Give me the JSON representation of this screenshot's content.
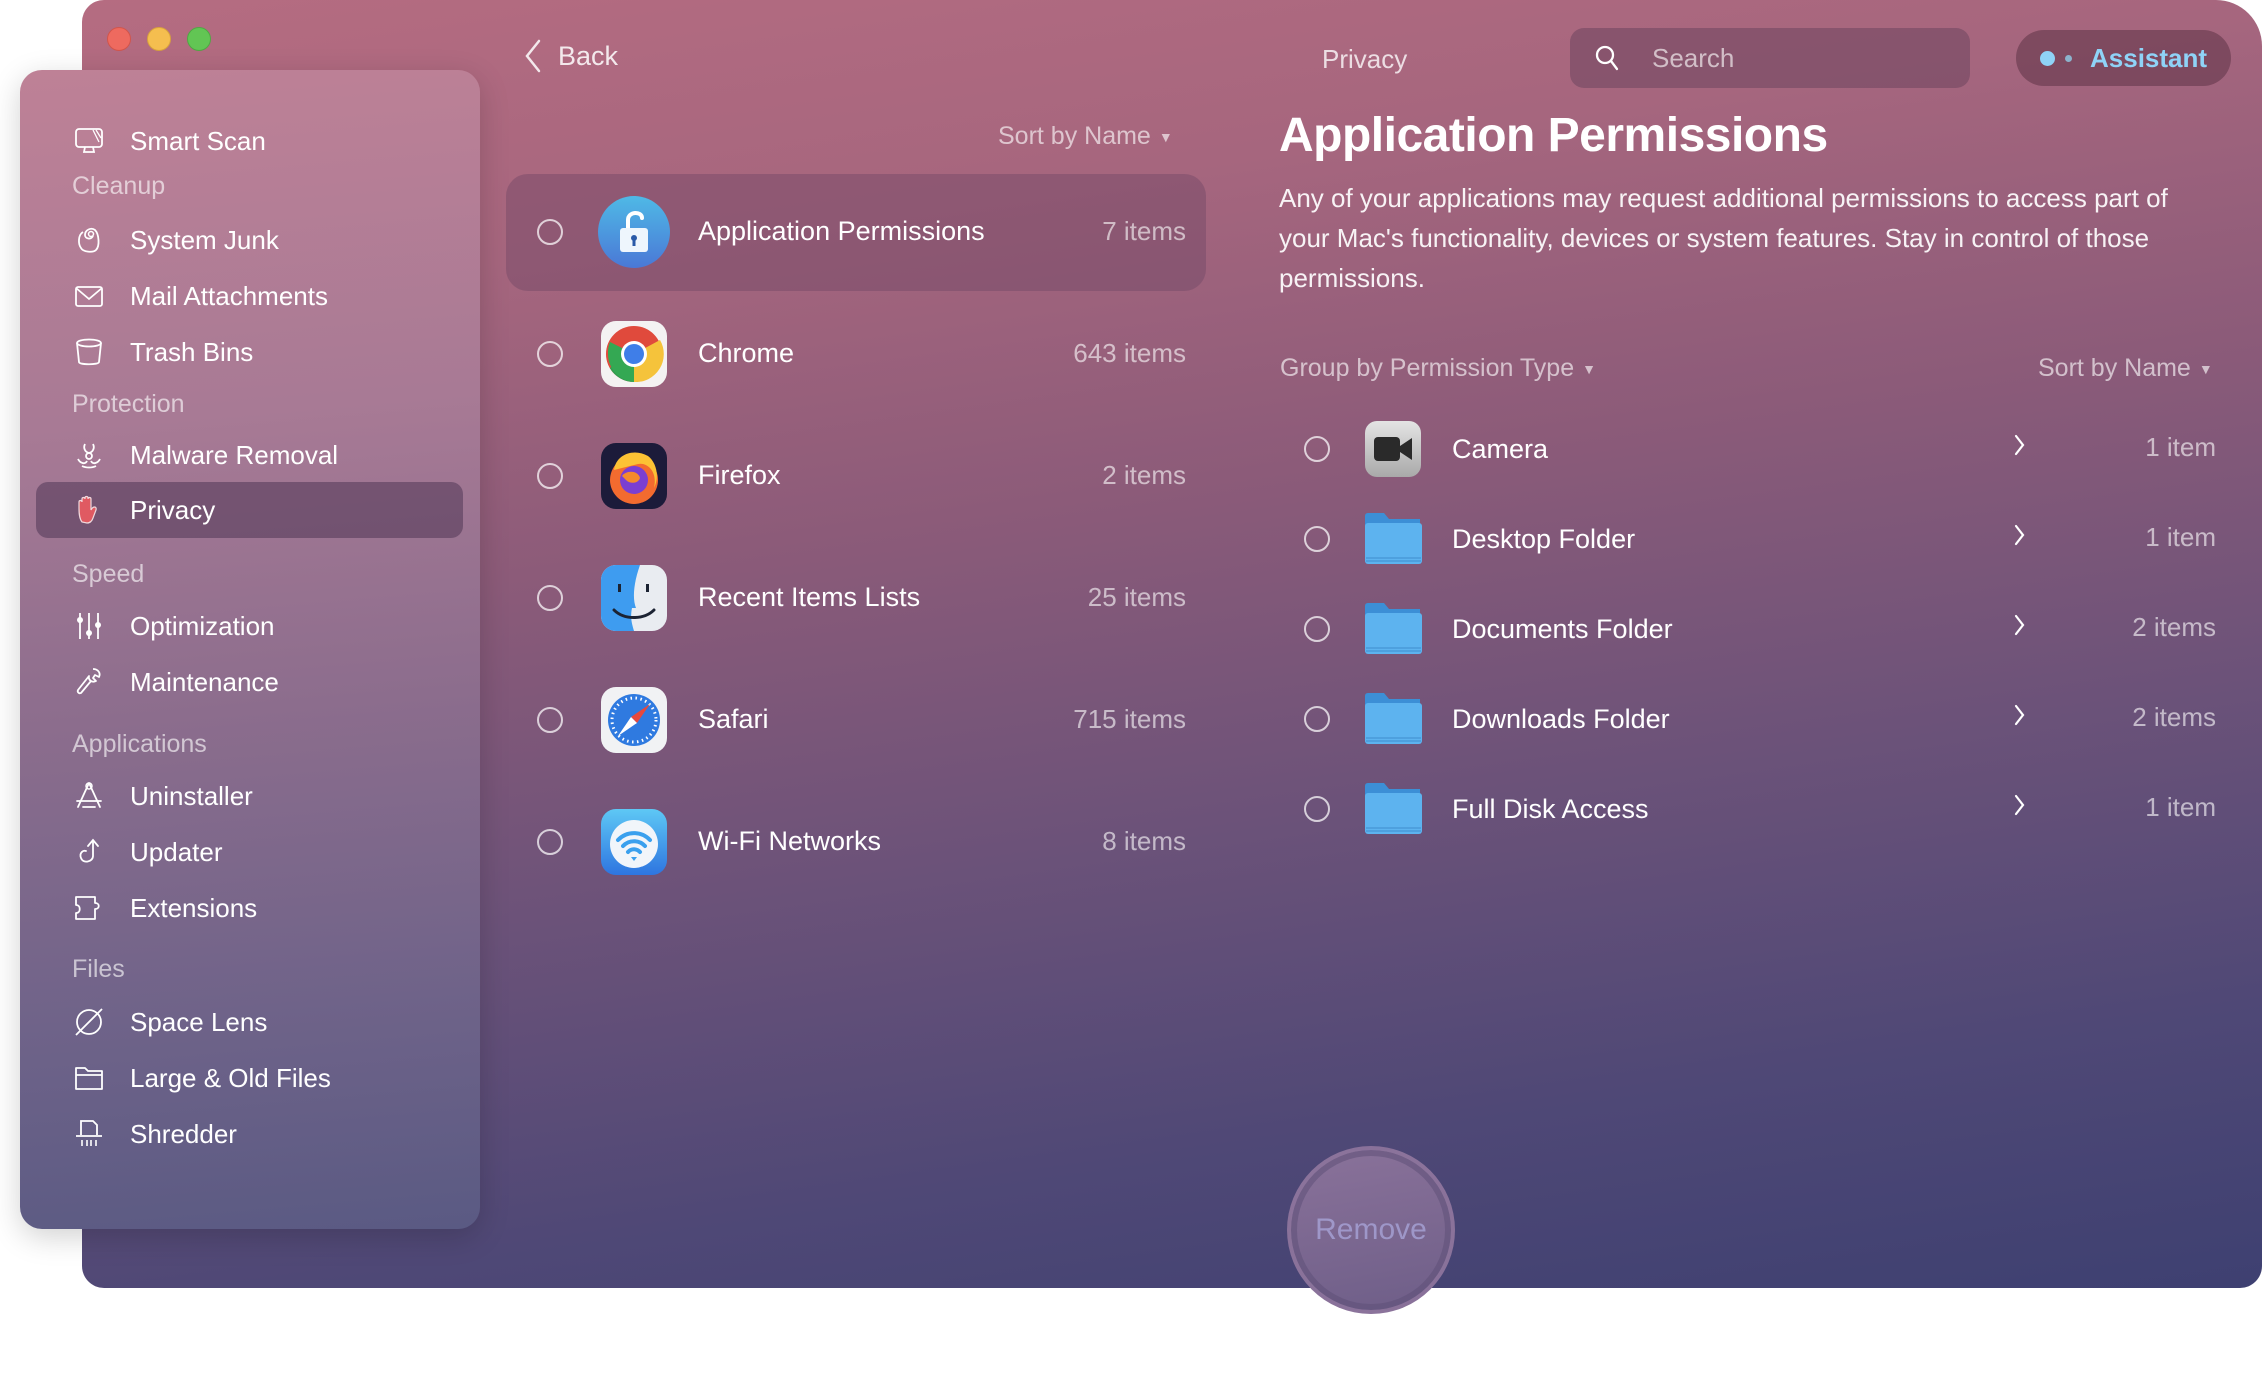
{
  "window": {
    "title": "Privacy",
    "traffic_lights": [
      "close",
      "minimize",
      "maximize"
    ]
  },
  "toolbar": {
    "back_label": "Back",
    "title": "Privacy",
    "search_placeholder": "Search",
    "search_value": "",
    "assistant_label": "Assistant"
  },
  "sidebar": {
    "top_item": {
      "label": "Smart Scan",
      "icon": "monitor-icon"
    },
    "sections": [
      {
        "title": "Cleanup",
        "items": [
          {
            "label": "System Junk",
            "icon": "system-junk-icon"
          },
          {
            "label": "Mail Attachments",
            "icon": "mail-icon"
          },
          {
            "label": "Trash Bins",
            "icon": "trash-icon"
          }
        ]
      },
      {
        "title": "Protection",
        "items": [
          {
            "label": "Malware Removal",
            "icon": "biohazard-icon"
          },
          {
            "label": "Privacy",
            "icon": "hand-icon",
            "selected": true
          }
        ]
      },
      {
        "title": "Speed",
        "items": [
          {
            "label": "Optimization",
            "icon": "sliders-icon"
          },
          {
            "label": "Maintenance",
            "icon": "wrench-icon"
          }
        ]
      },
      {
        "title": "Applications",
        "items": [
          {
            "label": "Uninstaller",
            "icon": "uninstaller-icon"
          },
          {
            "label": "Updater",
            "icon": "updater-arrow-icon"
          },
          {
            "label": "Extensions",
            "icon": "puzzle-icon"
          }
        ]
      },
      {
        "title": "Files",
        "items": [
          {
            "label": "Space Lens",
            "icon": "planet-icon"
          },
          {
            "label": "Large & Old Files",
            "icon": "folder-icon"
          },
          {
            "label": "Shredder",
            "icon": "shredder-icon"
          }
        ]
      }
    ]
  },
  "list": {
    "sort_label": "Sort by Name",
    "items": [
      {
        "name": "Application Permissions",
        "count": "7 items",
        "icon": "unlock-icon",
        "selected": true
      },
      {
        "name": "Chrome",
        "count": "643 items",
        "icon": "chrome-icon"
      },
      {
        "name": "Firefox",
        "count": "2 items",
        "icon": "firefox-icon"
      },
      {
        "name": "Recent Items Lists",
        "count": "25 items",
        "icon": "finder-icon"
      },
      {
        "name": "Safari",
        "count": "715 items",
        "icon": "safari-icon"
      },
      {
        "name": "Wi-Fi Networks",
        "count": "8 items",
        "icon": "wifi-icon"
      }
    ]
  },
  "detail": {
    "title": "Application Permissions",
    "description": "Any of your applications may request additional permissions to access part of your Mac's functionality, devices or system features. Stay in control of those permissions.",
    "group_label": "Group by Permission Type",
    "sort_label": "Sort by Name",
    "permissions": [
      {
        "name": "Camera",
        "count": "1 item",
        "icon": "camera-icon"
      },
      {
        "name": "Desktop Folder",
        "count": "1 item",
        "icon": "folder-icon"
      },
      {
        "name": "Documents Folder",
        "count": "2 items",
        "icon": "folder-icon"
      },
      {
        "name": "Downloads Folder",
        "count": "2 items",
        "icon": "folder-icon"
      },
      {
        "name": "Full Disk Access",
        "count": "1 item",
        "icon": "folder-icon"
      }
    ]
  },
  "actions": {
    "remove_label": "Remove"
  },
  "colors": {
    "accent_assistant": "#8fd3f7",
    "window_top": "#b56c81",
    "window_bottom": "#3e4071",
    "privacy_hand": "#e05a62"
  }
}
